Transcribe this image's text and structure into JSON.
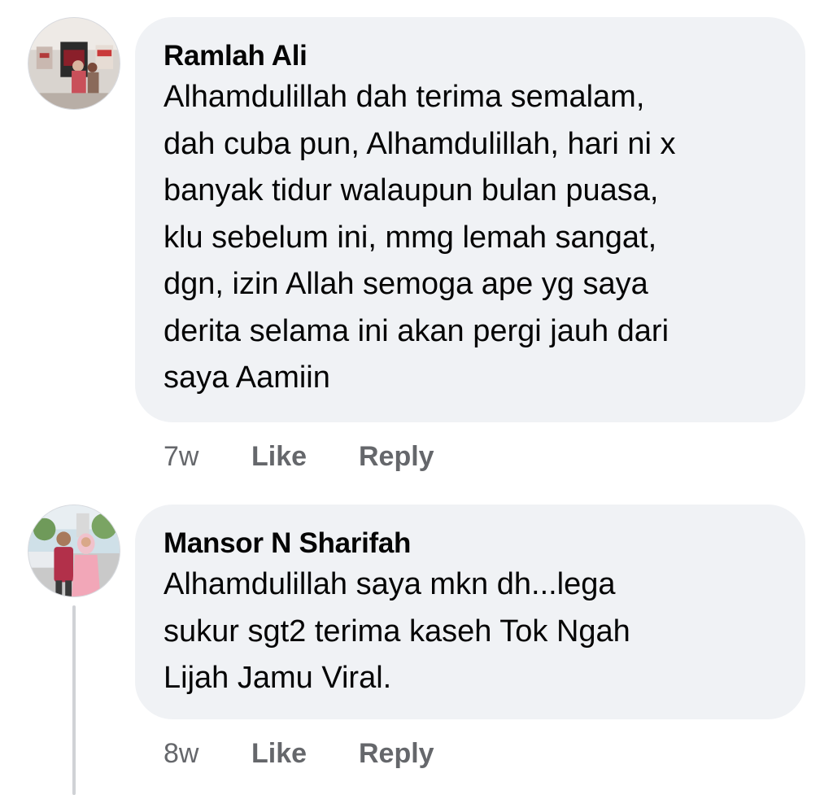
{
  "comments": [
    {
      "author": "Ramlah Ali",
      "avatar_icon": "profile-photo-icon",
      "text": "Alhamdulillah dah terima semalam,\ndah cuba pun, Alhamdulillah, hari ni x\nbanyak tidur walaupun bulan puasa,\nklu sebelum ini, mmg lemah sangat,\ndgn, izin Allah semoga ape yg saya\nderita selama ini akan pergi jauh dari\nsaya Aamiin",
      "time": "7w",
      "like_label": "Like",
      "reply_label": "Reply"
    },
    {
      "author": "Mansor N Sharifah",
      "avatar_icon": "profile-photo-icon",
      "text": "Alhamdulillah saya mkn dh...lega\nsukur sgt2 terima kaseh Tok Ngah\nLijah Jamu Viral.",
      "time": "8w",
      "like_label": "Like",
      "reply_label": "Reply"
    }
  ],
  "colors": {
    "bubble_bg": "#f0f2f5",
    "text": "#050505",
    "secondary_text": "#65676b",
    "thread_line": "#d0d2d6"
  }
}
